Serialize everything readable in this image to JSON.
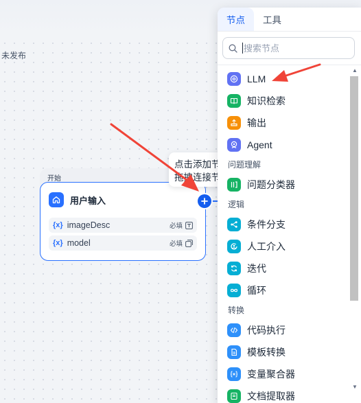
{
  "canvas": {
    "status": "未发布"
  },
  "start_node": {
    "label": "开始",
    "title": "用户输入",
    "variables": [
      {
        "symbol": "{x}",
        "name": "imageDesc",
        "required": "必填",
        "type_icon": "text-field-icon"
      },
      {
        "symbol": "{x}",
        "name": "model",
        "required": "必填",
        "type_icon": "select-icon"
      }
    ]
  },
  "tooltip": {
    "line1": "点击添加节点",
    "line2": "拖拽连接节点"
  },
  "panel": {
    "tabs": [
      {
        "label": "节点",
        "active": true
      },
      {
        "label": "工具",
        "active": false
      }
    ],
    "search": {
      "placeholder": "搜索节点",
      "value": ""
    },
    "items_top": [
      {
        "label": "LLM",
        "icon": "llm-icon",
        "color": "#6172f3"
      },
      {
        "label": "知识检索",
        "icon": "knowledge-icon",
        "color": "#16b364"
      },
      {
        "label": "输出",
        "icon": "output-icon",
        "color": "#f79009"
      },
      {
        "label": "Agent",
        "icon": "agent-icon",
        "color": "#6172f3"
      }
    ],
    "groups": [
      {
        "label": "问题理解",
        "items": [
          {
            "label": "问题分类器",
            "icon": "classifier-icon",
            "color": "#16b364"
          }
        ]
      },
      {
        "label": "逻辑",
        "items": [
          {
            "label": "条件分支",
            "icon": "branch-icon",
            "color": "#06aed4"
          },
          {
            "label": "人工介入",
            "icon": "human-icon",
            "color": "#06aed4"
          },
          {
            "label": "迭代",
            "icon": "iteration-icon",
            "color": "#06aed4"
          },
          {
            "label": "循环",
            "icon": "loop-icon",
            "color": "#06aed4"
          }
        ]
      },
      {
        "label": "转换",
        "items": [
          {
            "label": "代码执行",
            "icon": "code-icon",
            "color": "#2e90fa"
          },
          {
            "label": "模板转换",
            "icon": "template-icon",
            "color": "#2e90fa"
          },
          {
            "label": "变量聚合器",
            "icon": "aggregator-icon",
            "color": "#2e90fa"
          },
          {
            "label": "文档提取器",
            "icon": "doc-extract-icon",
            "color": "#16b364"
          }
        ]
      }
    ]
  },
  "colors": {
    "accent": "#155eef",
    "arrow": "#f04438"
  }
}
